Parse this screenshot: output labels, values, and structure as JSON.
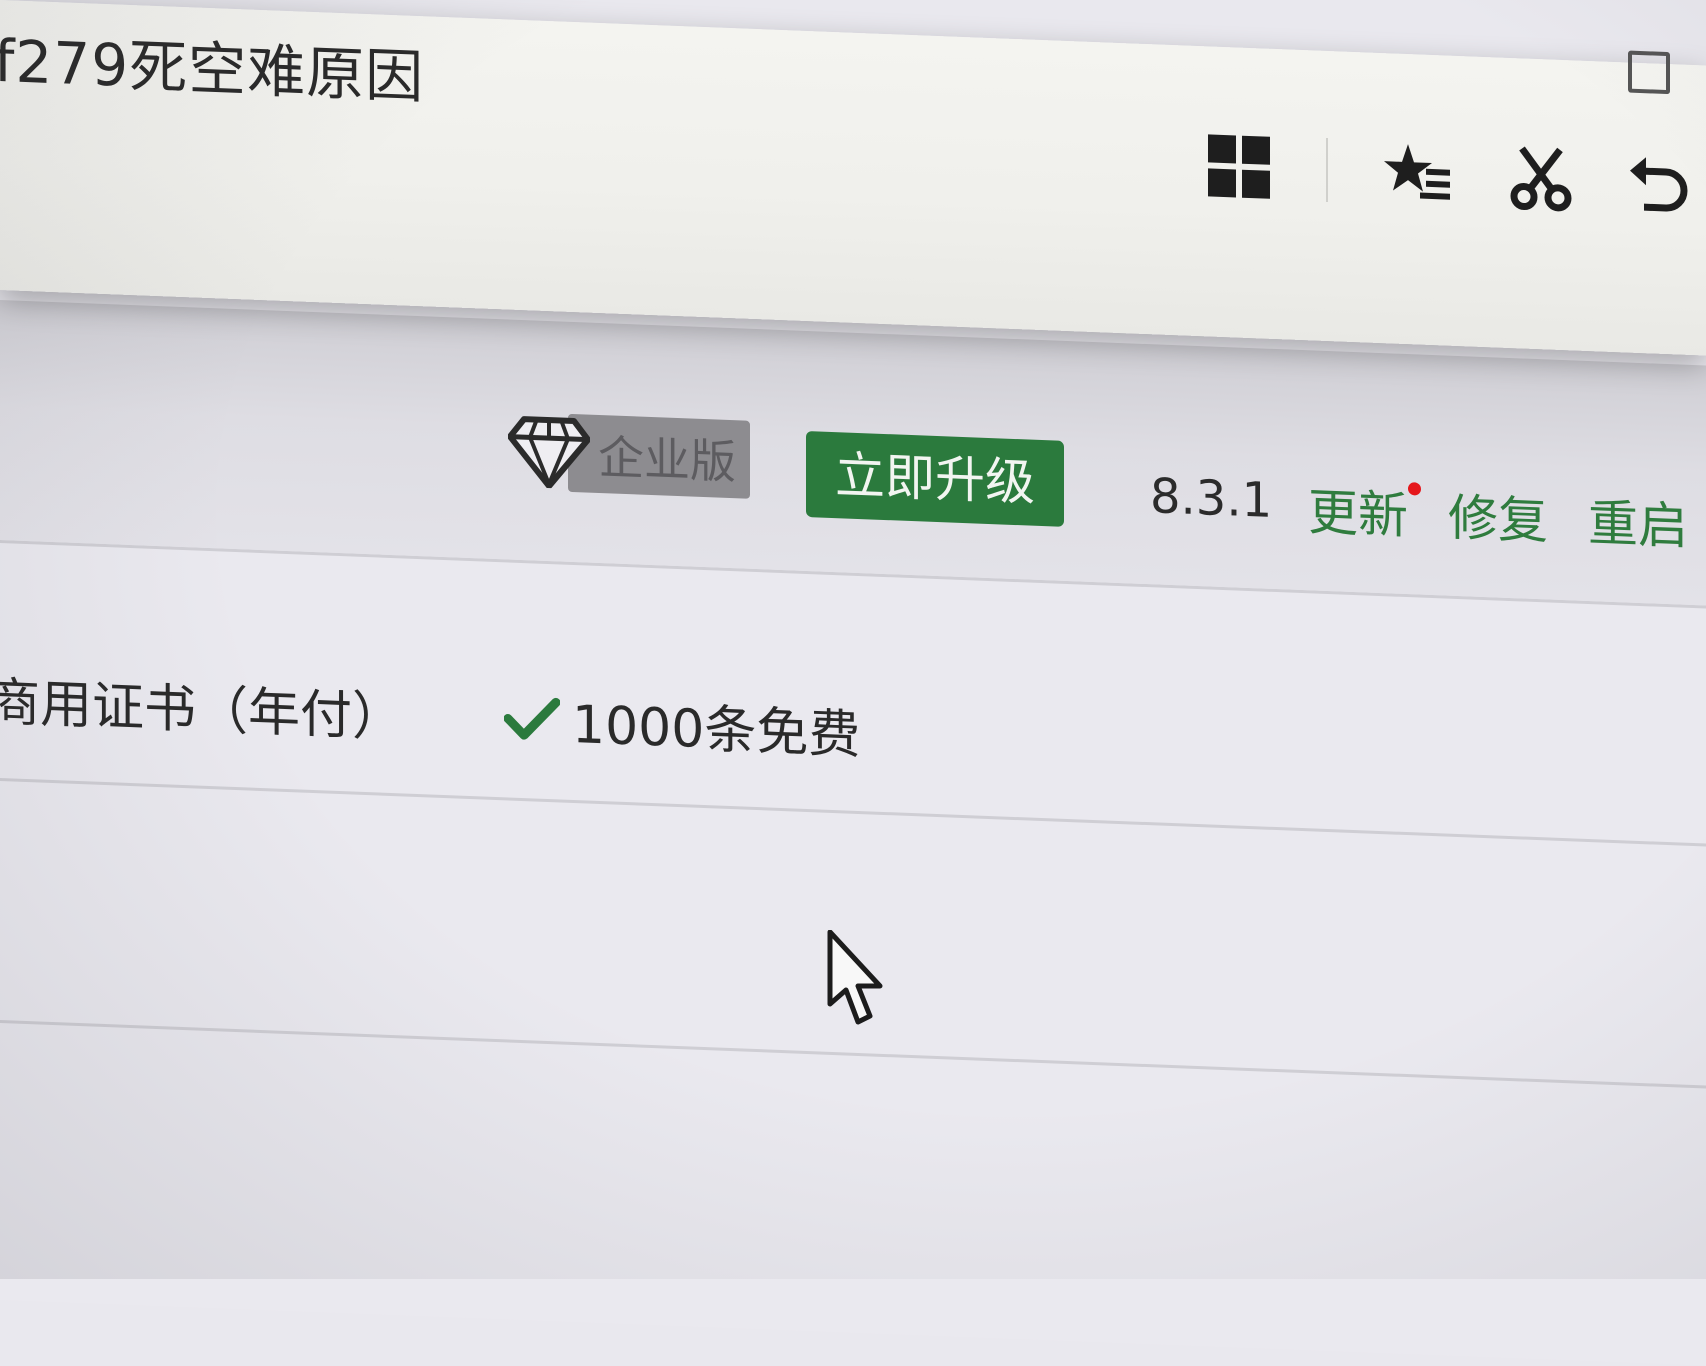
{
  "browser": {
    "page_title": "f279死空难原因"
  },
  "toolbar": {
    "icons": [
      "apps-grid-icon",
      "favorites-icon",
      "screenshot-scissors-icon",
      "undo-icon"
    ]
  },
  "header": {
    "edition_label": "企业版",
    "upgrade_label": "立即升级",
    "version": "8.3.1",
    "links": {
      "update": "更新",
      "repair": "修复",
      "restart": "重启"
    }
  },
  "features": {
    "row1": {
      "name": "商用证书（年付）",
      "value": "1000条免费"
    }
  },
  "colors": {
    "accent_green": "#2b7a3d",
    "link_green": "#2f7c3e",
    "notify_red": "#e5161b",
    "badge_gray": "#8d8c90"
  }
}
